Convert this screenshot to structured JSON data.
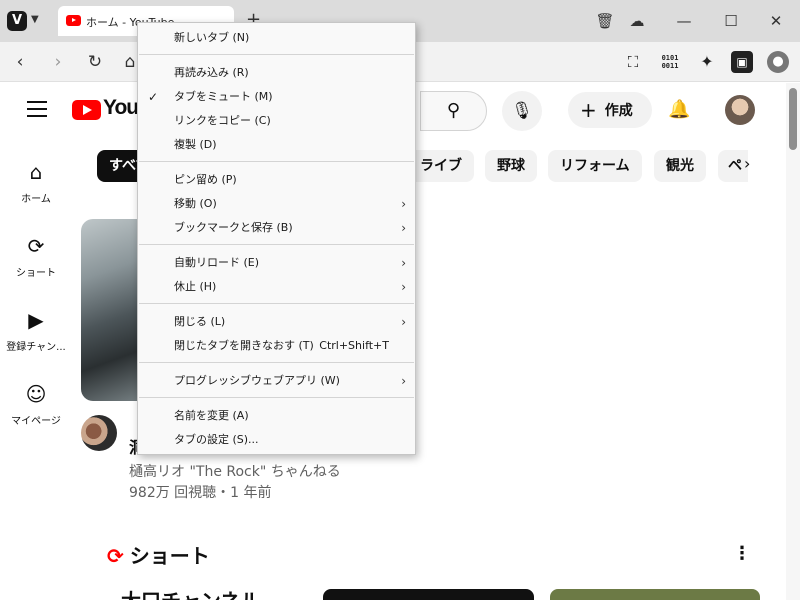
{
  "browser": {
    "tab_title": "ホーム - YouTube",
    "new_tab_symbol": "+",
    "window_controls": {
      "minimize": "—",
      "maximize": "☐",
      "close": "✕"
    }
  },
  "youtube": {
    "logo_text": "YouTube",
    "create_label": "作成",
    "sidebar": [
      {
        "label": "ホーム",
        "icon": "home-icon"
      },
      {
        "label": "ショート",
        "icon": "shorts-icon"
      },
      {
        "label": "登録チャン...",
        "icon": "subscriptions-icon"
      },
      {
        "label": "マイページ",
        "icon": "you-icon"
      }
    ],
    "chips": [
      "すべて",
      "ライブ",
      "野球",
      "リフォーム",
      "観光",
      "ペ"
    ],
    "video": {
      "title_partial": "洞",
      "channel": "樋高リオ \"The Rock\" ちゃんねる",
      "meta": "982万 回視聴・1 年前"
    },
    "shorts_heading": "ショート",
    "shorts_partial_title": "大口チャンネル"
  },
  "context_menu": {
    "items": [
      {
        "label": "新しいタブ (N)"
      },
      {
        "label": "再読み込み (R)"
      },
      {
        "label": "タブをミュート (M)",
        "checked": true
      },
      {
        "label": "リンクをコピー (C)"
      },
      {
        "label": "複製 (D)"
      },
      {
        "label": "ピン留め (P)"
      },
      {
        "label": "移動 (O)",
        "submenu": true
      },
      {
        "label": "ブックマークと保存 (B)",
        "submenu": true
      },
      {
        "label": "自動リロード (E)",
        "submenu": true
      },
      {
        "label": "休止 (H)",
        "submenu": true
      },
      {
        "label": "閉じる (L)",
        "submenu": true
      },
      {
        "label": "閉じたタブを開きなおす (T)",
        "shortcut": "Ctrl+Shift+T"
      },
      {
        "label": "プログレッシブウェブアプリ (W)",
        "submenu": true
      },
      {
        "label": "名前を変更 (A)"
      },
      {
        "label": "タブの設定 (S)..."
      }
    ]
  },
  "colors": {
    "accent_red": "#ff0000",
    "menu_bg": "#f9f9f9",
    "tabbar_bg": "#dcdcdc"
  }
}
